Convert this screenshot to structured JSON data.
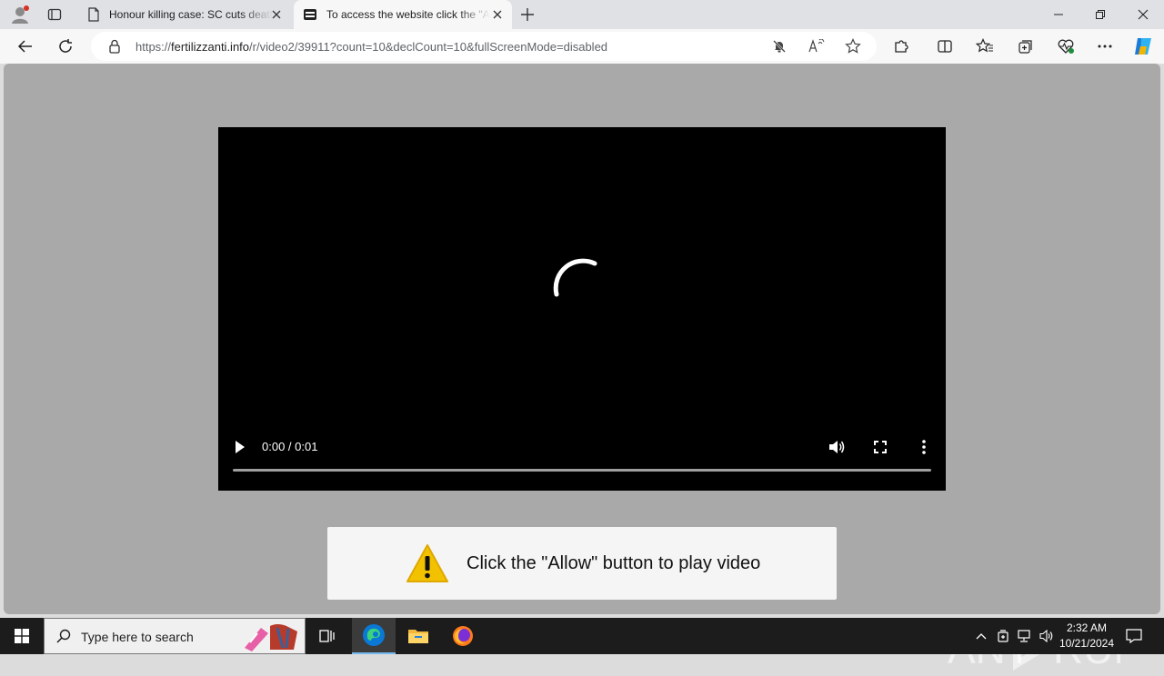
{
  "browser": {
    "tabs": [
      {
        "title": "Honour killing case: SC cuts death"
      },
      {
        "title": "To access the website click the \"Allow\""
      }
    ],
    "address": {
      "scheme": "https://",
      "host": "fertilizzanti.info",
      "path": "/r/video2/39911?count=10&declCount=10&fullScreenMode=disabled"
    }
  },
  "icons": {
    "profile": "profile-icon",
    "tab_actions": "tab-actions-icon",
    "page": "page-icon",
    "site": "site-icon",
    "close": "close-icon",
    "new_tab": "plus-icon",
    "back": "back-arrow-icon",
    "refresh": "refresh-icon",
    "lock": "lock-icon",
    "notifications_blocked": "bell-slash-icon",
    "read_aloud": "read-aloud-icon",
    "favorite": "star-icon",
    "extensions": "puzzle-icon",
    "split_screen": "split-screen-icon",
    "favorites": "favorites-icon",
    "collections": "collections-icon",
    "browser_essentials": "heart-pulse-icon",
    "more": "ellipsis-icon",
    "copilot": "copilot-icon"
  },
  "video": {
    "time": "0:00 / 0:01",
    "progress": 0
  },
  "notice": {
    "message": "Click the \"Allow\" button to play video"
  },
  "watermark": {
    "text_left": "ANY",
    "text_right": "RUN"
  },
  "taskbar": {
    "search_placeholder": "Type here to search",
    "time": "2:32 AM",
    "date": "10/21/2024"
  },
  "colors": {
    "page_bg": "#a9a9a9",
    "warning_yellow": "#f2c200",
    "edge_blue": "#0a78d4"
  }
}
